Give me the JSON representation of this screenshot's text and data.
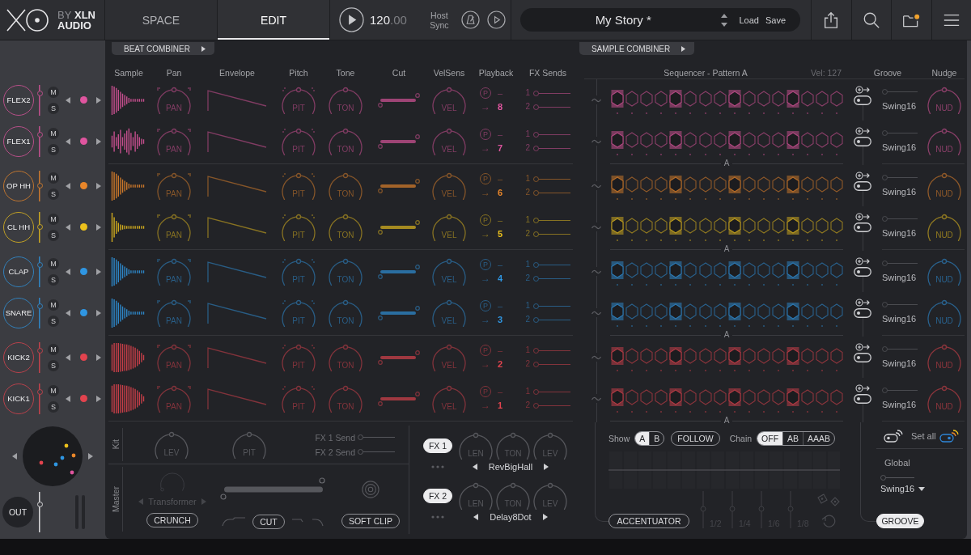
{
  "logo": {
    "by": "BY",
    "line1": "XLN",
    "line2": "AUDIO"
  },
  "tabs": [
    {
      "label": "SPACE",
      "selected": false
    },
    {
      "label": "EDIT",
      "selected": true
    }
  ],
  "transport": {
    "tempo": "120",
    "tempo_fraction": ".00",
    "sync": "Host Sync"
  },
  "preset": {
    "name": "My Story *",
    "load": "Load",
    "save": "Save"
  },
  "combiners": {
    "beat": "BEAT COMBINER",
    "sample": "SAMPLE COMBINER"
  },
  "columns": [
    "Sample",
    "Pan",
    "Envelope",
    "Pitch",
    "Tone",
    "Cut",
    "VelSens",
    "Playback",
    "FX Sends"
  ],
  "sequencer": {
    "title": "Sequencer - Pattern A",
    "velocity": "Vel: 127",
    "groove": "Groove",
    "nudge": "Nudge"
  },
  "groups": [
    {
      "divider": "A",
      "tracks": [
        {
          "name": "FLEX2",
          "kind": "decay",
          "color": "#e0559f",
          "level": 0.75,
          "mute": "M",
          "solo": "S",
          "pan": "PAN",
          "pitch": "PIT",
          "tone": "TON",
          "cut": {
            "level": 1
          },
          "velocity": "VEL",
          "mode": "P",
          "choke": "–",
          "arrow": "→",
          "output": "8",
          "sends": [
            {
              "label": "1",
              "level": 0
            },
            {
              "label": "2",
              "level": 0
            }
          ],
          "steps": [
            true,
            false,
            false,
            false,
            true,
            false,
            false,
            false,
            true,
            false,
            false,
            false,
            true,
            false,
            false,
            false
          ],
          "groove": {
            "level": 0,
            "preset": "Swing16"
          },
          "nudge": "NUD"
        },
        {
          "name": "FLEX1",
          "kind": "burst",
          "color": "#e0559f",
          "level": 0.75,
          "mute": "M",
          "solo": "S",
          "pan": "PAN",
          "pitch": "PIT",
          "tone": "TON",
          "cut": {
            "level": 1
          },
          "velocity": "VEL",
          "mode": "P",
          "choke": "–",
          "arrow": "→",
          "output": "7",
          "sends": [
            {
              "label": "1",
              "level": 0
            },
            {
              "label": "2",
              "level": 0
            }
          ],
          "steps": [
            true,
            false,
            false,
            false,
            true,
            false,
            false,
            false,
            true,
            false,
            false,
            false,
            true,
            false,
            false,
            false
          ],
          "groove": {
            "level": 0,
            "preset": "Swing16"
          },
          "nudge": "NUD"
        }
      ]
    },
    {
      "divider": "A",
      "tracks": [
        {
          "name": "OP HH",
          "kind": "decay",
          "color": "#e8862a",
          "level": 0.5,
          "mute": "M",
          "solo": "S",
          "pan": "PAN",
          "pitch": "PIT",
          "tone": "TON",
          "cut": {
            "level": 1
          },
          "velocity": "VEL",
          "mode": "P",
          "choke": "–",
          "arrow": "→",
          "output": "6",
          "sends": [
            {
              "label": "1",
              "level": 0
            },
            {
              "label": "2",
              "level": 0
            }
          ],
          "steps": [
            true,
            false,
            false,
            false,
            true,
            false,
            false,
            false,
            true,
            false,
            false,
            false,
            true,
            false,
            false,
            false
          ],
          "groove": {
            "level": 0,
            "preset": "Swing16"
          },
          "nudge": "NUD"
        },
        {
          "name": "CL HH",
          "kind": "short",
          "color": "#ecc11c",
          "level": 0.5,
          "mute": "M",
          "solo": "S",
          "pan": "PAN",
          "pitch": "PIT",
          "tone": "TON",
          "cut": {
            "level": 1
          },
          "velocity": "VEL",
          "mode": "P",
          "choke": "–",
          "arrow": "→",
          "output": "5",
          "sends": [
            {
              "label": "1",
              "level": 0
            },
            {
              "label": "2",
              "level": 0
            }
          ],
          "steps": [
            true,
            false,
            false,
            false,
            true,
            false,
            false,
            false,
            true,
            false,
            false,
            false,
            true,
            false,
            false,
            false
          ],
          "groove": {
            "level": 0,
            "preset": "Swing16"
          },
          "nudge": "NUD"
        }
      ]
    },
    {
      "divider": "A",
      "tracks": [
        {
          "name": "CLAP",
          "kind": "decay",
          "color": "#2f96e2",
          "level": 0.75,
          "mute": "M",
          "solo": "S",
          "pan": "PAN",
          "pitch": "PIT",
          "tone": "TON",
          "cut": {
            "level": 1
          },
          "velocity": "VEL",
          "mode": "P",
          "choke": "–",
          "arrow": "→",
          "output": "4",
          "sends": [
            {
              "label": "1",
              "level": 0
            },
            {
              "label": "2",
              "level": 0
            }
          ],
          "steps": [
            true,
            false,
            false,
            false,
            true,
            false,
            false,
            false,
            true,
            false,
            false,
            false,
            true,
            false,
            false,
            false
          ],
          "groove": {
            "level": 0,
            "preset": "Swing16"
          },
          "nudge": "NUD"
        },
        {
          "name": "SNARE",
          "kind": "decay",
          "color": "#2f96e2",
          "level": 0.75,
          "mute": "M",
          "solo": "S",
          "pan": "PAN",
          "pitch": "PIT",
          "tone": "TON",
          "cut": {
            "level": 1
          },
          "velocity": "VEL",
          "mode": "P",
          "choke": "–",
          "arrow": "→",
          "output": "3",
          "sends": [
            {
              "label": "1",
              "level": 0
            },
            {
              "label": "2",
              "level": 0
            }
          ],
          "steps": [
            true,
            false,
            false,
            false,
            true,
            false,
            false,
            false,
            true,
            false,
            false,
            false,
            true,
            false,
            false,
            false
          ],
          "groove": {
            "level": 0,
            "preset": "Swing16"
          },
          "nudge": "NUD"
        }
      ]
    },
    {
      "divider": "A",
      "tracks": [
        {
          "name": "KICK2",
          "kind": "sustain",
          "color": "#e2434e",
          "level": 0.75,
          "mute": "M",
          "solo": "S",
          "pan": "PAN",
          "pitch": "PIT",
          "tone": "TON",
          "cut": {
            "level": 1
          },
          "velocity": "VEL",
          "mode": "P",
          "choke": "–",
          "arrow": "→",
          "output": "2",
          "sends": [
            {
              "label": "1",
              "level": 0
            },
            {
              "label": "2",
              "level": 0
            }
          ],
          "steps": [
            true,
            false,
            false,
            false,
            true,
            false,
            false,
            false,
            true,
            false,
            false,
            false,
            true,
            false,
            false,
            false
          ],
          "groove": {
            "level": 0,
            "preset": "Swing16"
          },
          "nudge": "NUD"
        },
        {
          "name": "KICK1",
          "kind": "sustain",
          "color": "#e2434e",
          "level": 0.75,
          "mute": "M",
          "solo": "S",
          "pan": "PAN",
          "pitch": "PIT",
          "tone": "TON",
          "cut": {
            "level": 1
          },
          "velocity": "VEL",
          "mode": "P",
          "choke": "–",
          "arrow": "→",
          "output": "1",
          "sends": [
            {
              "label": "1",
              "level": 0
            },
            {
              "label": "2",
              "level": 0
            }
          ],
          "steps": [
            true,
            false,
            false,
            false,
            true,
            false,
            false,
            false,
            true,
            false,
            false,
            false,
            true,
            false,
            false,
            false
          ],
          "groove": {
            "level": 0,
            "preset": "Swing16"
          },
          "nudge": "NUD"
        }
      ]
    }
  ],
  "kit": {
    "label": "Kit",
    "knobs": [
      "LEV",
      "PIT"
    ],
    "sends": [
      {
        "label": "FX 1 Send",
        "level": 0
      },
      {
        "label": "FX 2 Send",
        "level": 0
      }
    ]
  },
  "master": {
    "label": "Master",
    "crunch": {
      "label": "CRUNCH",
      "on": false,
      "preset": "Transformer"
    },
    "range": {
      "level": 1
    },
    "cut": {
      "label": "CUT",
      "on": false
    },
    "soft_clip": {
      "label": "SOFT CLIP",
      "on": false
    }
  },
  "fx": [
    {
      "label": "FX 1",
      "on": true,
      "knobs": [
        "LEN",
        "TON",
        "LEV"
      ],
      "preset": "RevBigHall"
    },
    {
      "label": "FX 2",
      "on": true,
      "knobs": [
        "LEN",
        "TON",
        "LEV"
      ],
      "preset": "Delay8Dot"
    }
  ],
  "pattern": {
    "show": "Show",
    "pages": [
      {
        "label": "A",
        "selected": true
      },
      {
        "label": "B",
        "selected": false
      }
    ],
    "follow": {
      "label": "FOLLOW",
      "on": false
    },
    "chain": "Chain",
    "chain_modes": [
      {
        "label": "OFF",
        "selected": true
      },
      {
        "label": "AB",
        "selected": false
      },
      {
        "label": "AAAB",
        "selected": false
      }
    ]
  },
  "accentuator": {
    "divisions": [
      {
        "label": "1/2",
        "disabled": true
      },
      {
        "label": "1/4",
        "disabled": true
      },
      {
        "label": "1/6",
        "disabled": true
      },
      {
        "label": "1/8",
        "disabled": true
      }
    ],
    "button": {
      "label": "ACCENTUATOR",
      "on": false
    }
  },
  "groove_panel": {
    "set_all": "Set all",
    "global": "Global",
    "level": 0,
    "preset": "Swing16",
    "button": {
      "label": "GROOVE",
      "on": true
    }
  },
  "out": {
    "label": "OUT",
    "level": 0.7
  }
}
